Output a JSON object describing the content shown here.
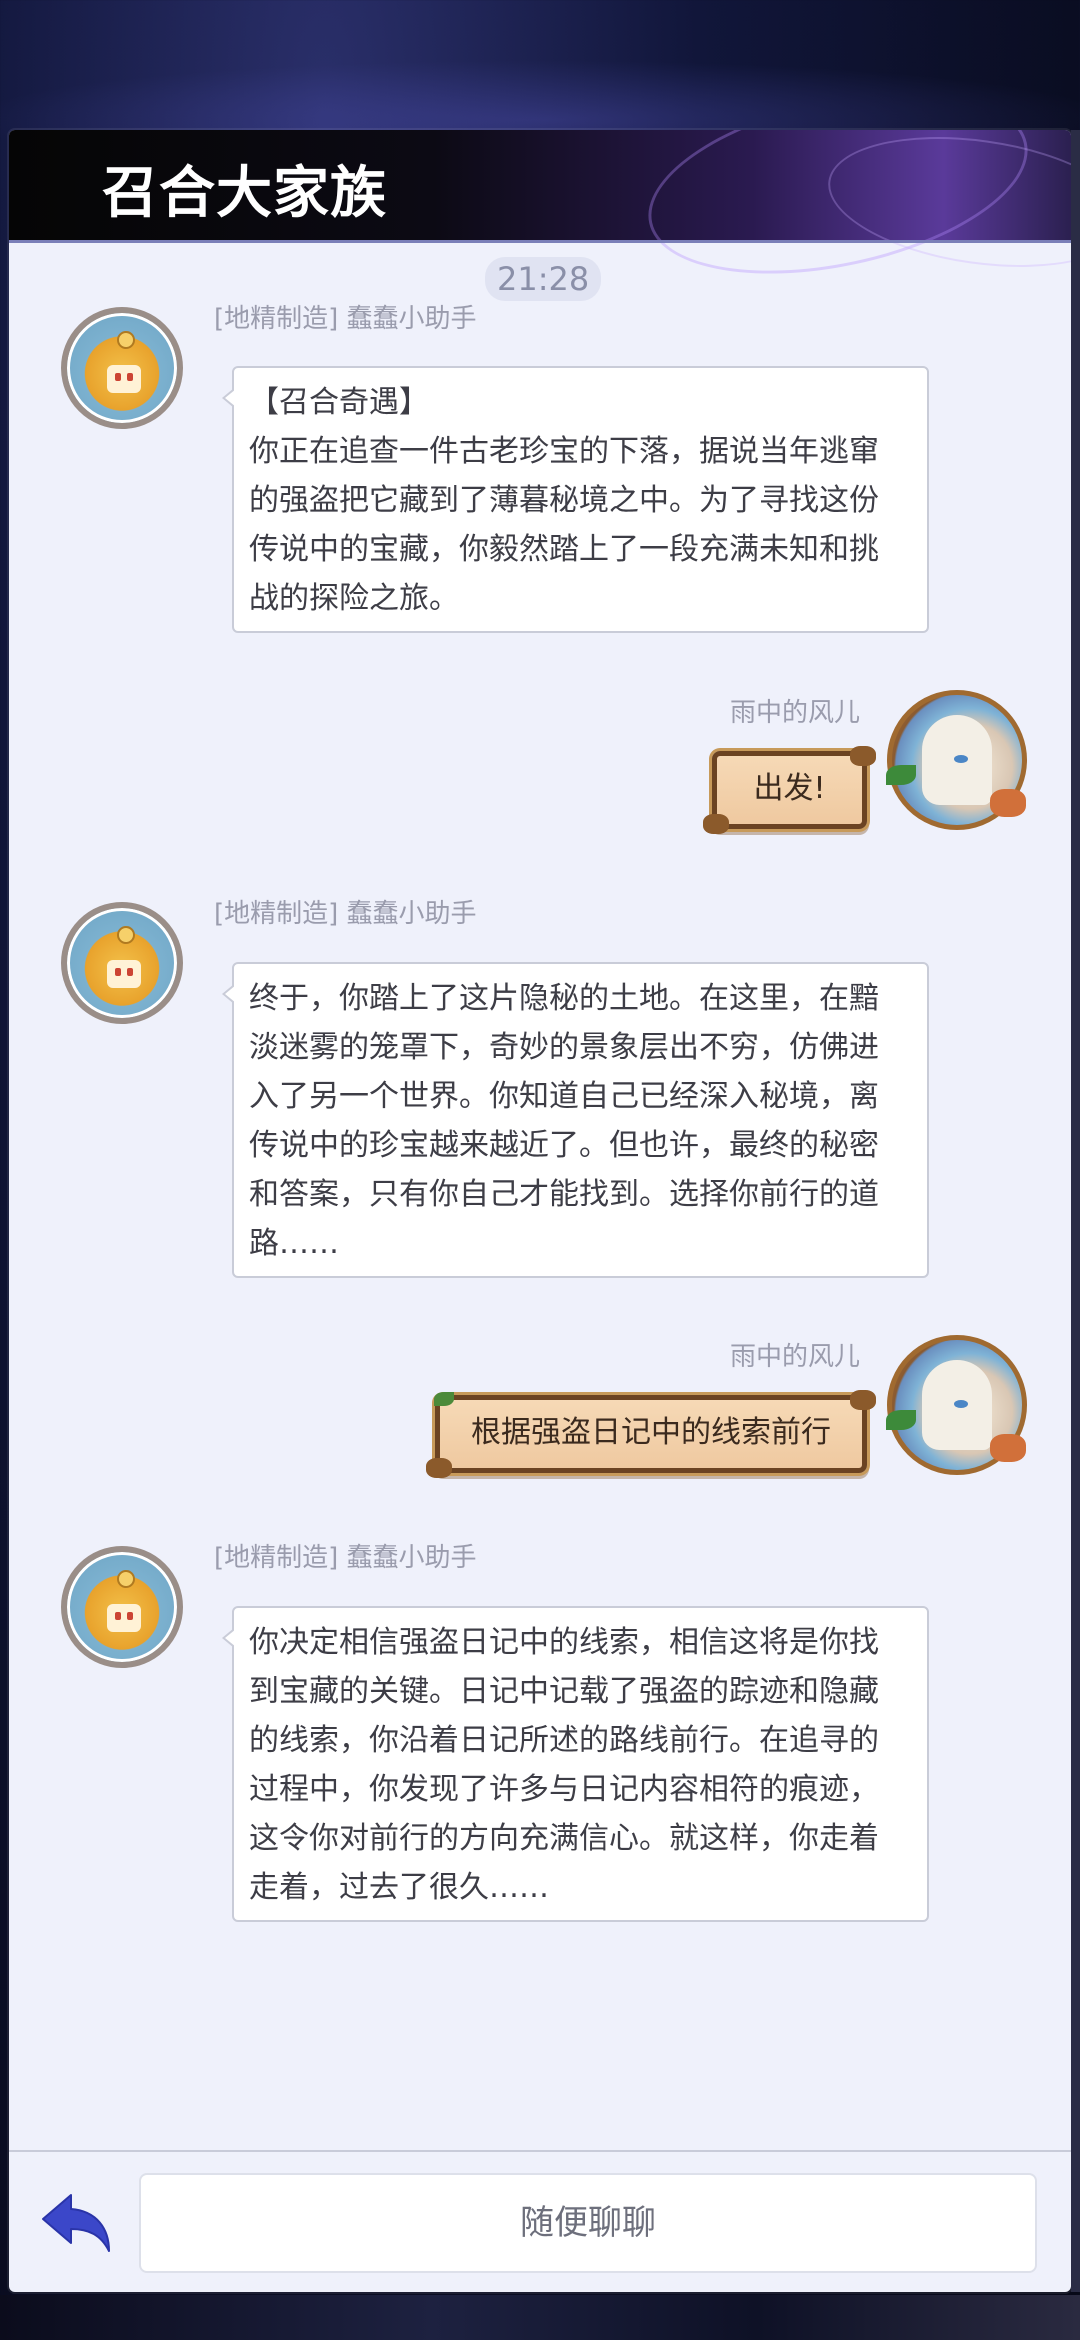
{
  "header": {
    "title": "召合大家族"
  },
  "chat": {
    "time": "21:28",
    "messages": [
      {
        "sender": "[地精制造] 蠢蠢小助手",
        "lines": [
          "【召合奇遇】",
          "你正在追查一件古老珍宝的下落，据说当年逃窜",
          "的强盗把它藏到了薄暮秘境之中。为了寻找这份",
          "传说中的宝藏，你毅然踏上了一段充满未知和挑",
          "战的探险之旅。"
        ]
      },
      {
        "sender": "雨中的风儿",
        "text": "出发!"
      },
      {
        "sender": "[地精制造] 蠢蠢小助手",
        "lines": [
          "终于，你踏上了这片隐秘的土地。在这里，在黯",
          "淡迷雾的笼罩下，奇妙的景象层出不穷，仿佛进",
          "入了另一个世界。你知道自己已经深入秘境，离",
          "传说中的珍宝越来越近了。但也许，最终的秘密",
          "和答案，只有你自己才能找到。选择你前行的道",
          "路……"
        ]
      },
      {
        "sender": "雨中的风儿",
        "text": "根据强盗日记中的线索前行"
      },
      {
        "sender": "[地精制造] 蠢蠢小助手",
        "lines": [
          "你决定相信强盗日记中的线索，相信这将是你找",
          "到宝藏的关键。日记中记载了强盗的踪迹和隐藏",
          "的线索，你沿着日记所述的路线前行。在追寻的",
          "过程中，你发现了许多与日记内容相符的痕迹，",
          "这令你对前行的方向充满信心。就这样，你走着",
          "走着，过去了很久……"
        ]
      }
    ]
  },
  "input": {
    "placeholder": "随便聊聊"
  },
  "icons": {
    "back": "back-arrow-icon"
  },
  "colors": {
    "accent": "#3b47c9",
    "panel": "#eff1fb",
    "header": "#050505"
  }
}
